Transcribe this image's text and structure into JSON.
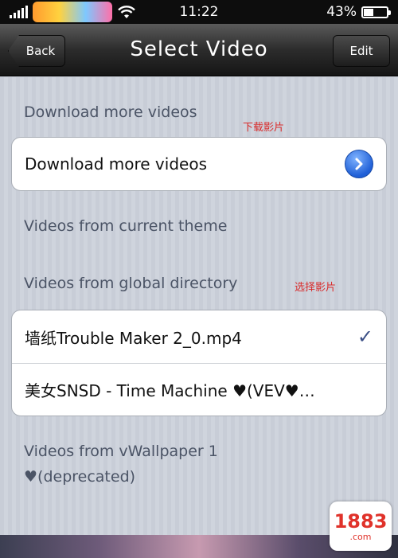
{
  "status_bar": {
    "carrier_logo_text": "",
    "time": "11:22",
    "battery": "43%",
    "battery_level": 0.43
  },
  "nav": {
    "back_label": "Back",
    "title": "Select Video",
    "edit_label": "Edit"
  },
  "sections": {
    "download_header": "Download more videos",
    "download_annotation": "下载影片",
    "download_cell": "Download more videos",
    "current_theme_header": "Videos from current theme",
    "global_header": "Videos from global directory",
    "global_annotation": "选择影片",
    "global_items": [
      {
        "label": "墙纸Trouble Maker 2_0.mp4",
        "selected": true
      },
      {
        "label": "美女SNSD - Time Machine ♥(VEV♥…",
        "selected": false
      }
    ],
    "vwallpaper_header_line1": "Videos from vWallpaper 1",
    "vwallpaper_header_line2": "♥(deprecated)"
  },
  "watermark": {
    "number": "1883",
    "sub": ".com"
  },
  "colors": {
    "accent_blue": "#1f5fd6",
    "annotation_red": "#d92b2b",
    "nav_dark": "#2c2c2c"
  }
}
